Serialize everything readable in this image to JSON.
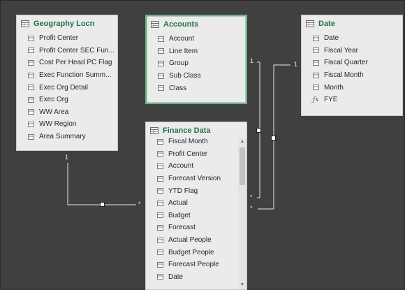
{
  "tables": [
    {
      "title": "Geography Locn",
      "fields": [
        "Profit Center",
        "Profit Center SEC Fun...",
        "Cost Per Head PC Flag",
        "Exec Function Summ...",
        "Exec Org Detail",
        "Exec Org",
        "WW Area",
        "WW Region",
        "Area Summary"
      ]
    },
    {
      "title": "Accounts",
      "fields": [
        "Account",
        "Line Item",
        "Group",
        "Sub Class",
        "Class"
      ]
    },
    {
      "title": "Date",
      "fields": [
        "Date",
        "Fiscal Year",
        "Fiscal Quarter",
        "Fiscal Month",
        "Month",
        "FYE"
      ]
    },
    {
      "title": "Finance Data",
      "fields": [
        "Fiscal Month",
        "Profit Center",
        "Account",
        "Forecast Version",
        "YTD Flag",
        "Actual",
        "Budget",
        "Forecast",
        "Actual People",
        "Budget People",
        "Forecast People",
        "Date"
      ]
    }
  ],
  "cardinality": {
    "one": "1",
    "many": "*"
  },
  "icons": {
    "table": "table-icon",
    "field": "column-icon",
    "measure": "fx-icon"
  },
  "colors": {
    "background": "#404040",
    "title": "#217346",
    "selected_border": "#6fb28a"
  }
}
